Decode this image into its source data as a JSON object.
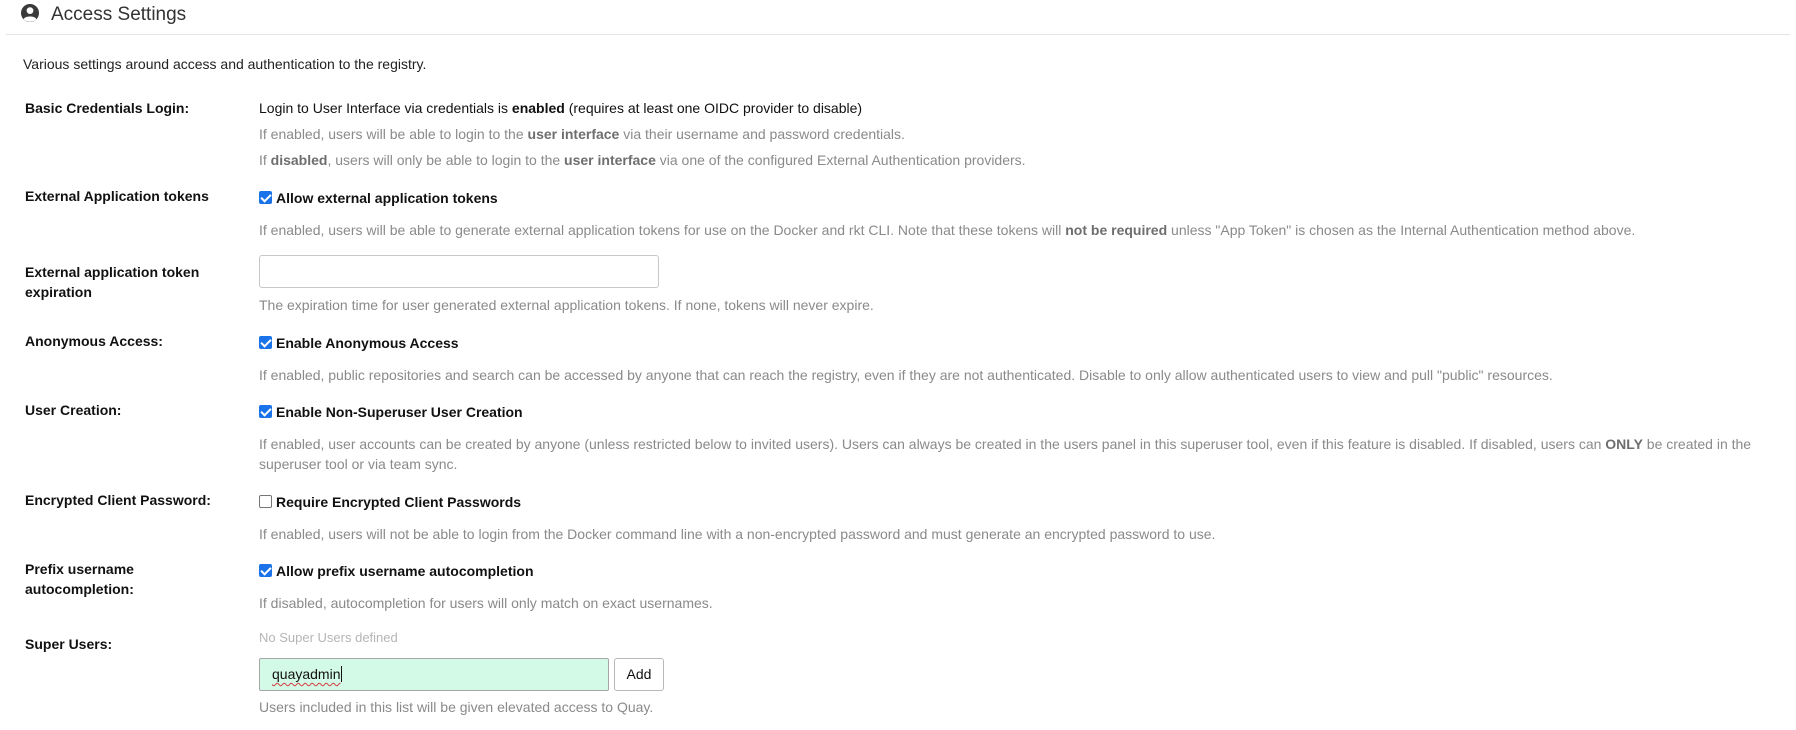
{
  "header": {
    "title": "Access Settings",
    "icon": "user-circle-icon"
  },
  "intro": "Various settings around access and authentication to the registry.",
  "basic_credentials": {
    "label": "Basic Credentials Login:",
    "status": {
      "prefix": "Login to User Interface via credentials is ",
      "state": "enabled",
      "suffix": " (requires at least one OIDC provider to disable)"
    },
    "help1": {
      "a": "If enabled, users will be able to login to the ",
      "b": "user interface",
      "c": " via their username and password credentials."
    },
    "help2": {
      "a": "If ",
      "b": "disabled",
      "c": ", users will only be able to login to the ",
      "d": "user interface",
      "e": " via one of the configured External Authentication providers."
    }
  },
  "external_tokens": {
    "label": "External Application tokens",
    "checkbox_label": "Allow external application tokens",
    "checked": true,
    "help": {
      "a": "If enabled, users will be able to generate external application tokens for use on the Docker and rkt CLI. Note that these tokens will ",
      "b": "not be required",
      "c": " unless \"App Token\" is chosen as the Internal Authentication method above."
    }
  },
  "token_expiration": {
    "label": "External application token expiration",
    "value": "",
    "help": "The expiration time for user generated external application tokens. If none, tokens will never expire."
  },
  "anonymous_access": {
    "label": "Anonymous Access:",
    "checkbox_label": "Enable Anonymous Access",
    "checked": true,
    "help": "If enabled, public repositories and search can be accessed by anyone that can reach the registry, even if they are not authenticated. Disable to only allow authenticated users to view and pull \"public\" resources."
  },
  "user_creation": {
    "label": "User Creation:",
    "checkbox_label": "Enable Non-Superuser User Creation",
    "checked": true,
    "help": {
      "a": "If enabled, user accounts can be created by anyone (unless restricted below to invited users). Users can always be created in the users panel in this superuser tool, even if this feature is disabled. If disabled, users can ",
      "b": "ONLY",
      "c": " be created in the superuser tool or via team sync."
    }
  },
  "encrypted_password": {
    "label": "Encrypted Client Password:",
    "checkbox_label": "Require Encrypted Client Passwords",
    "checked": false,
    "help": "If enabled, users will not be able to login from the Docker command line with a non-encrypted password and must generate an encrypted password to use."
  },
  "prefix_autocomplete": {
    "label": "Prefix username autocompletion:",
    "checkbox_label": "Allow prefix username autocompletion",
    "checked": true,
    "help": "If disabled, autocompletion for users will only match on exact usernames."
  },
  "super_users": {
    "label": "Super Users:",
    "empty_text": "No Super Users defined",
    "input_value": "quayadmin",
    "add_label": "Add",
    "help": "Users included in this list will be given elevated access to Quay."
  },
  "colors": {
    "checkbox_accent": "#1a73e8",
    "input_highlight": "#d3f9e7",
    "help_text": "#8a8a8a"
  }
}
